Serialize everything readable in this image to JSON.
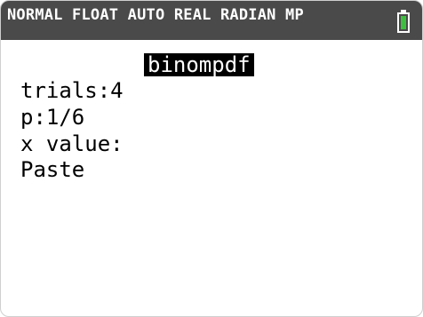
{
  "status_bar": {
    "modes": "NORMAL FLOAT AUTO REAL RADIAN MP",
    "battery_icon": "battery-icon",
    "battery_color": "#3fbf3f"
  },
  "wizard": {
    "title": "binompdf",
    "fields": {
      "trials": {
        "label": "trials:",
        "value": "4"
      },
      "p": {
        "label": "p:",
        "value": "1/6"
      },
      "x_value": {
        "label": "x value:",
        "value": ""
      }
    },
    "paste_label": "Paste"
  }
}
